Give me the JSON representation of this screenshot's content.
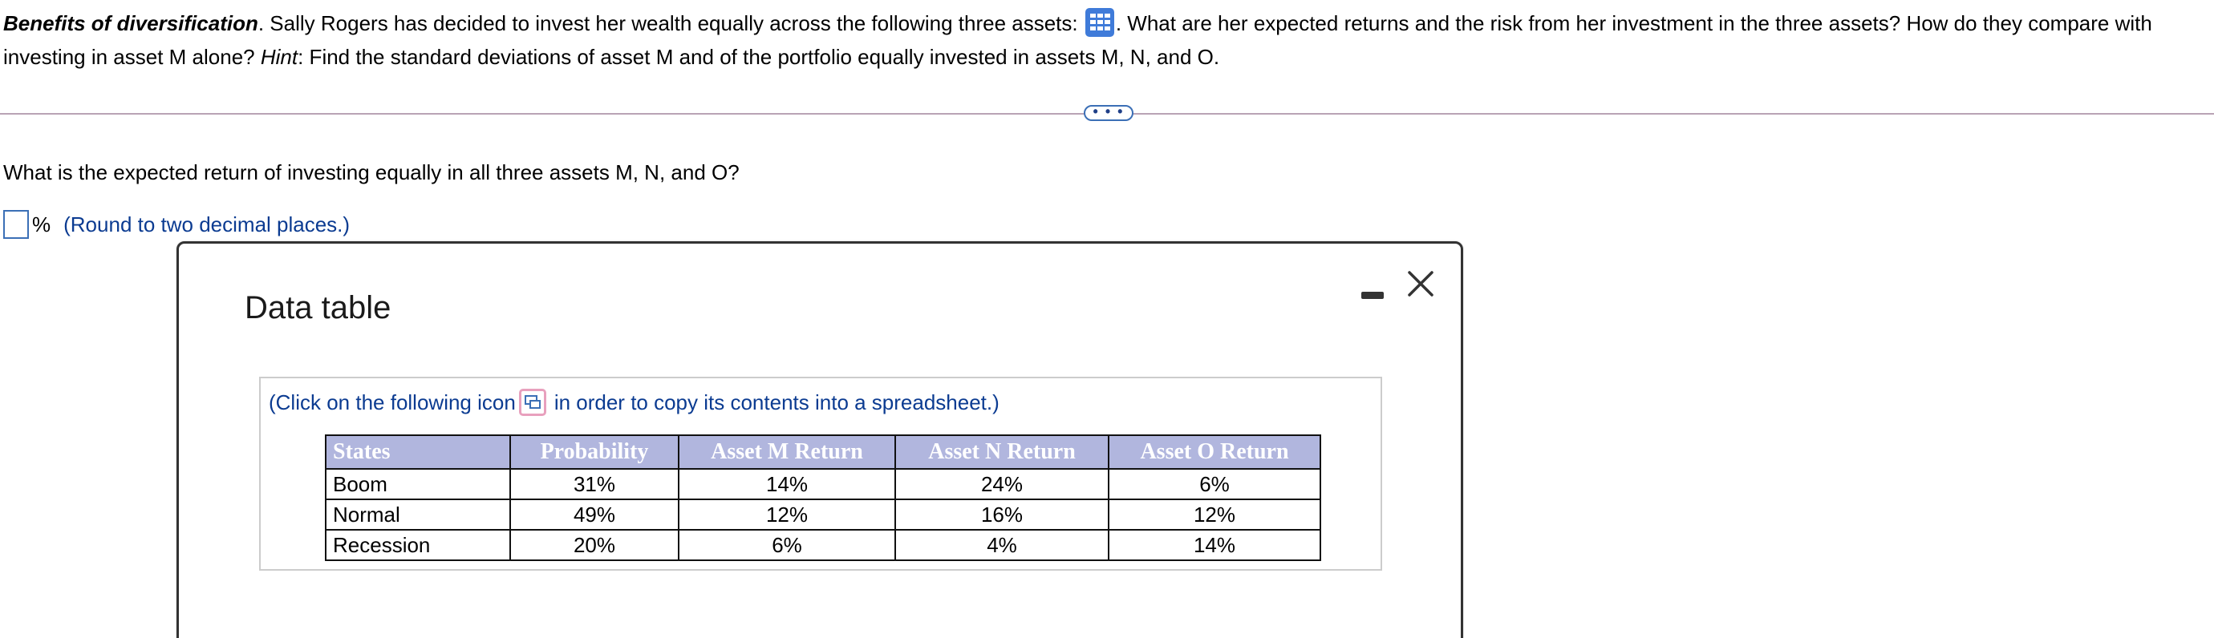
{
  "question": {
    "title": "Benefits of diversification",
    "title_period": ".",
    "text_part1": " Sally Rogers has decided to invest her wealth equally across the following three assets: ",
    "text_part2": ". What are her expected returns and the risk from her investment in the three assets? How do they compare with investing in asset M alone? ",
    "hint_label": "Hint",
    "hint_text": ": Find the standard deviations of asset M and of the portfolio equally invested in assets M, N, and O.",
    "grid_icon": "table-grid-icon"
  },
  "expand_button": {
    "label": "• • •"
  },
  "sub_question": "What is the expected return of investing equally in all three assets M, N, and O?",
  "answer": {
    "value": "",
    "unit": "%",
    "instruction": "(Round to two decimal places.)"
  },
  "modal": {
    "title": "Data table",
    "copy_note_before": "(Click on the following icon",
    "copy_note_after": "in order to copy its contents into a spreadsheet.)",
    "copy_icon": "copy-icon",
    "minimize_icon": "minimize-icon",
    "close_icon": "close-icon",
    "table": {
      "headers": [
        "States",
        "Probability",
        "Asset M Return",
        "Asset N Return",
        "Asset O Return"
      ],
      "rows": [
        [
          "Boom",
          "31%",
          "14%",
          "24%",
          "6%"
        ],
        [
          "Normal",
          "49%",
          "12%",
          "16%",
          "12%"
        ],
        [
          "Recession",
          "20%",
          "6%",
          "4%",
          "14%"
        ]
      ]
    }
  },
  "colors": {
    "header_bg": "#b1b6de",
    "link_blue": "#0b3b91",
    "icon_blue": "#3f7bd9",
    "copy_icon_border": "#e8a0bd"
  }
}
